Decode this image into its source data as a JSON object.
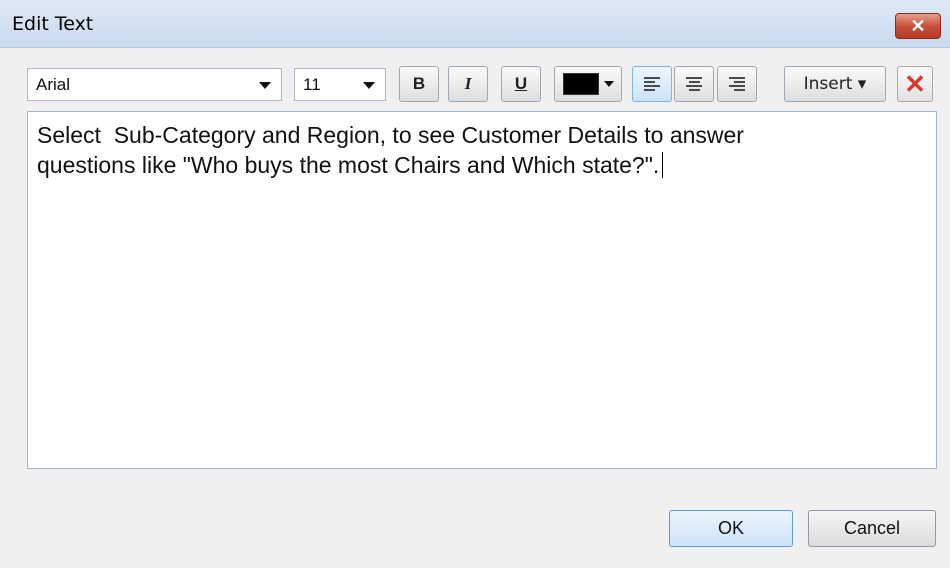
{
  "window": {
    "title": "Edit Text",
    "close_label": "✕"
  },
  "toolbar": {
    "font_family": "Arial",
    "font_size": "11",
    "bold_label": "B",
    "italic_label": "I",
    "underline_label": "U",
    "text_color": "#000000",
    "align_left_active": true,
    "insert_label": "Insert ▾",
    "clear_label": "✕"
  },
  "editor": {
    "text": "Select  Sub-Category and Region, to see Customer Details to answer\nquestions like \"Who buys the most Chairs and Which state?\"."
  },
  "buttons": {
    "ok": "OK",
    "cancel": "Cancel"
  },
  "icons": {
    "close": "close-icon",
    "align_left": "align-left-icon",
    "align_center": "align-center-icon",
    "align_right": "align-right-icon",
    "delete": "delete-x-icon"
  },
  "colors": {
    "accent": "#7fb4e3",
    "close_red": "#c8513c",
    "delete_red": "#d9372a"
  }
}
